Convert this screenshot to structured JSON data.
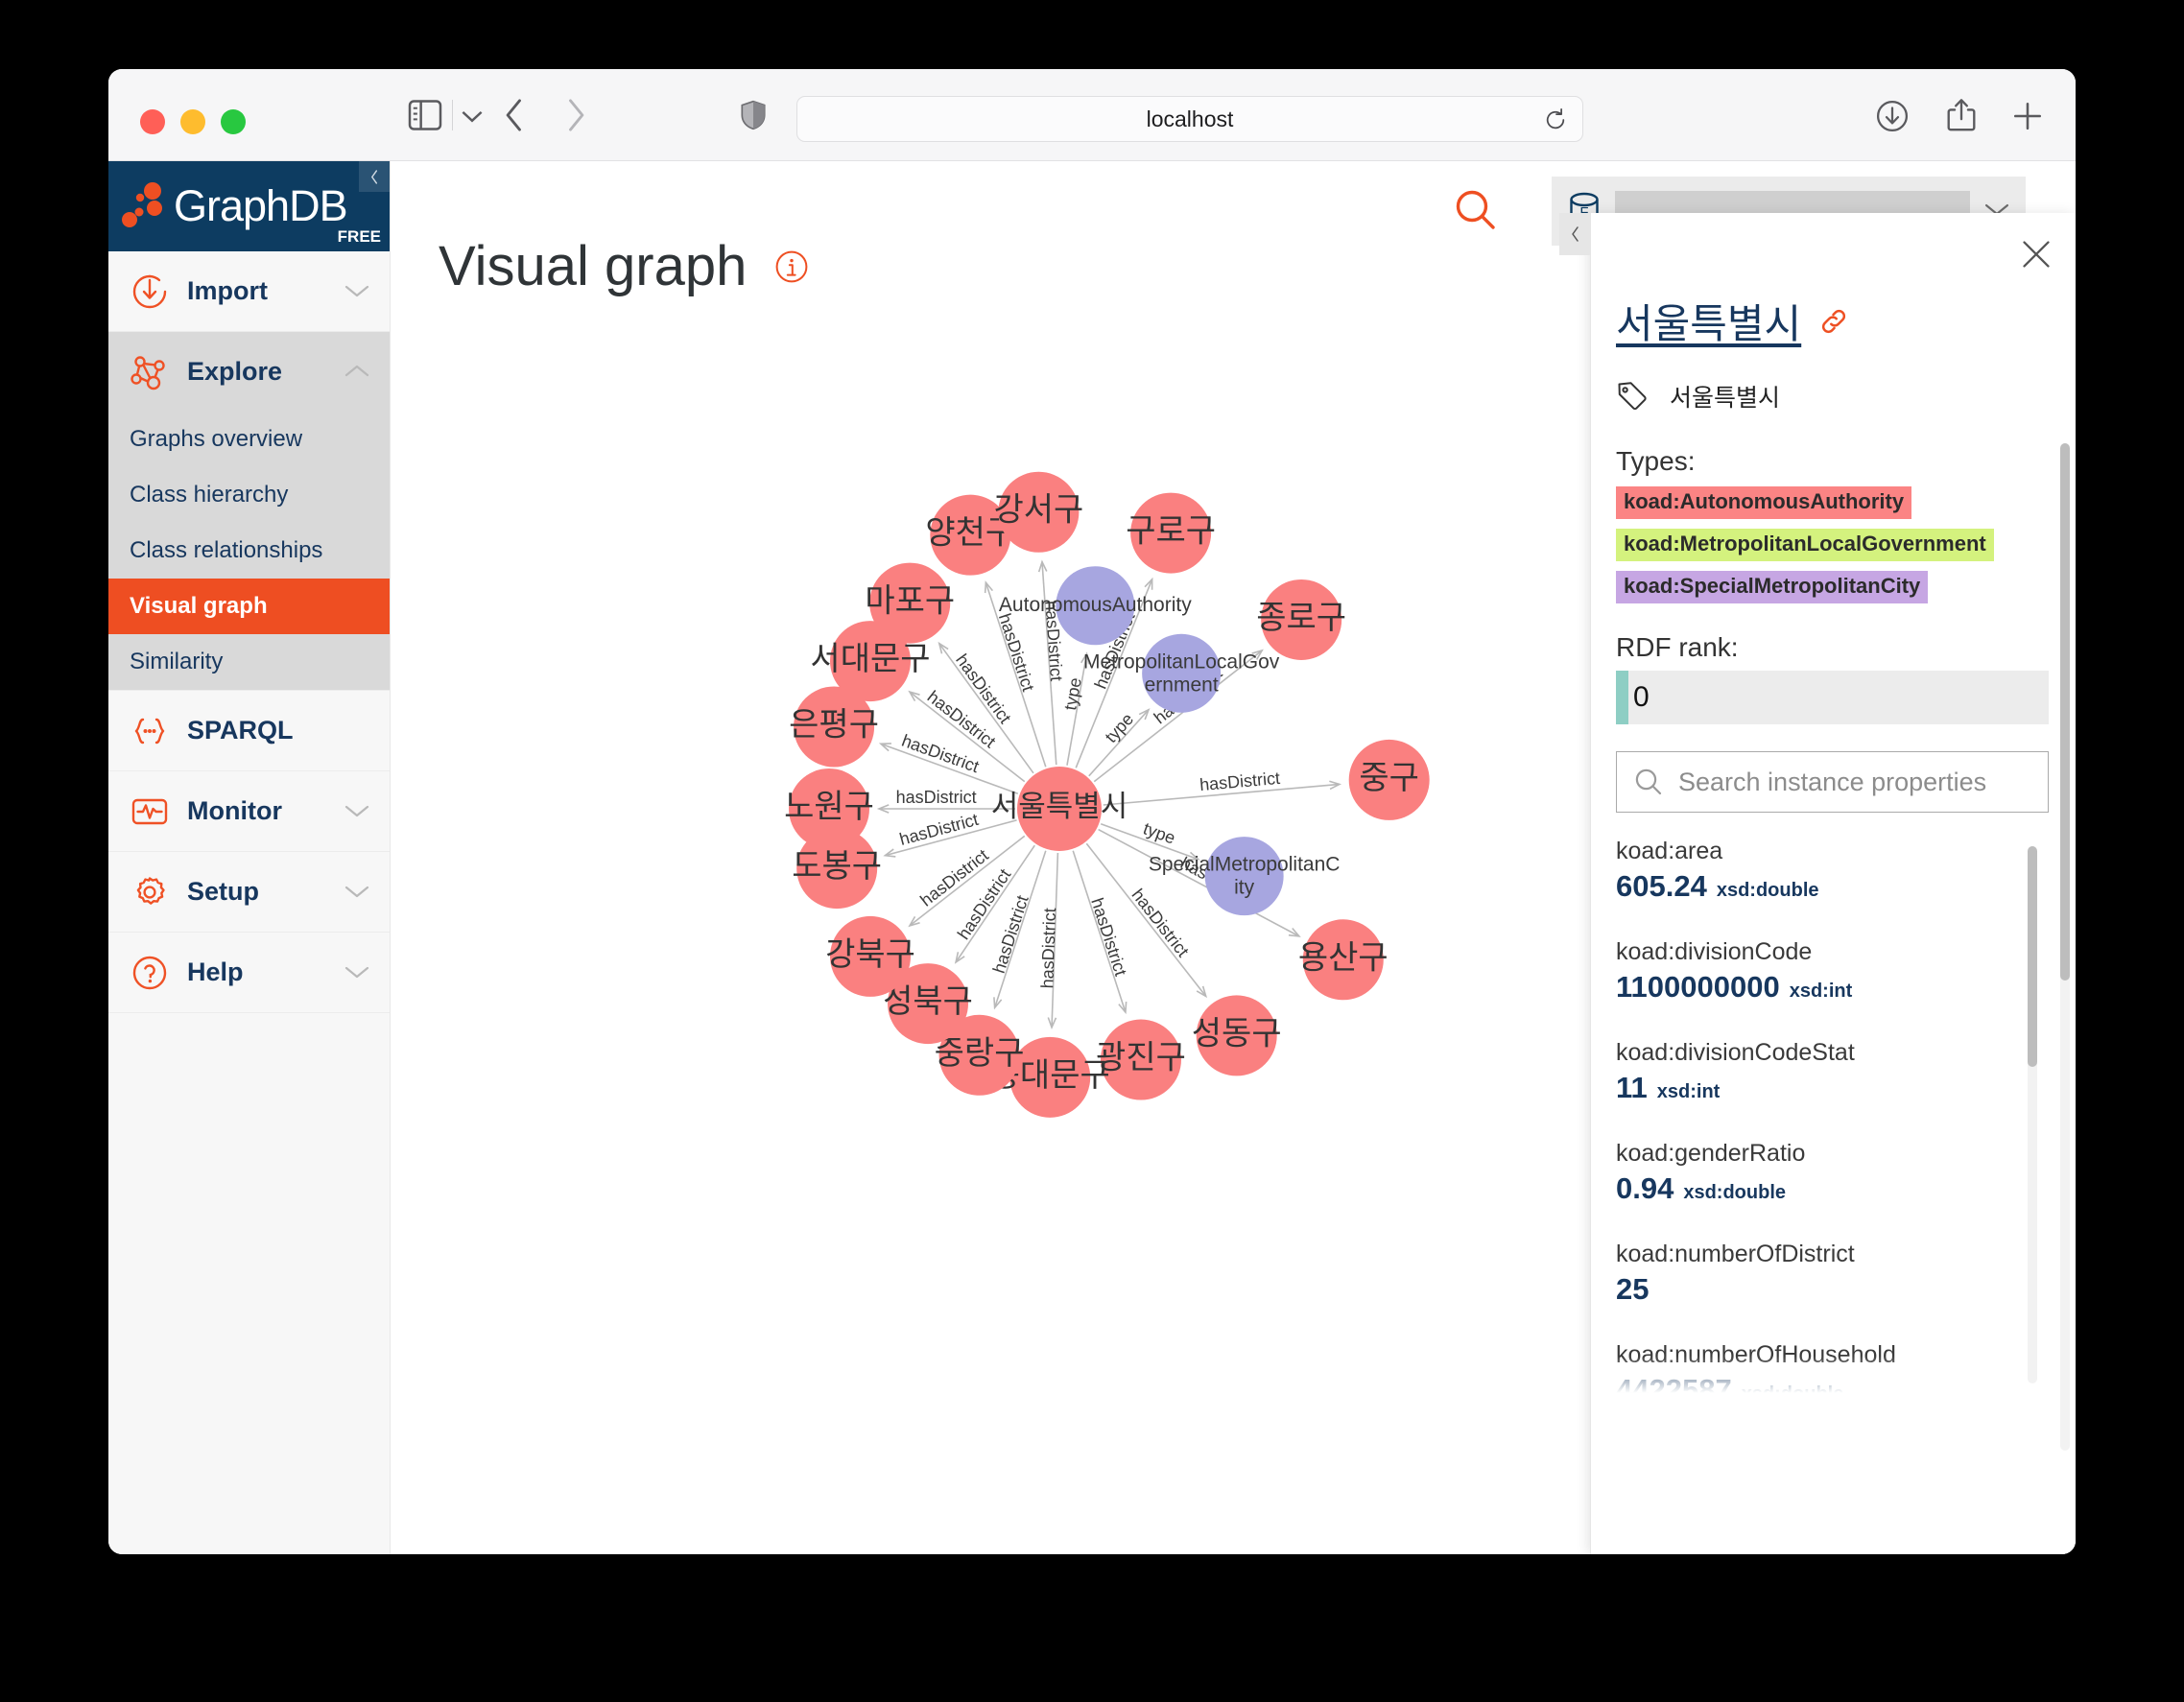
{
  "browser": {
    "url": "localhost",
    "icons": {
      "sidebar_toggle": "sidebar-toggle-icon",
      "sidebar_chevron": "chevron-down-icon",
      "back": "chevron-left-icon",
      "forward": "chevron-right-icon",
      "shield": "shield-icon",
      "reload": "reload-icon",
      "download": "download-icon",
      "share": "share-icon",
      "newtab": "plus-icon",
      "tabgroups": "tab-overview-icon"
    }
  },
  "sidebar": {
    "brand": "GraphDB",
    "edition_badge": "FREE",
    "collapse_label": "‹",
    "groups": [
      {
        "label": "Import",
        "icon": "import-icon",
        "chevron": "chevron-down",
        "open": false,
        "items": []
      },
      {
        "label": "Explore",
        "icon": "explore-graph-icon",
        "chevron": "chevron-up",
        "open": true,
        "items": [
          {
            "label": "Graphs overview",
            "active": false
          },
          {
            "label": "Class hierarchy",
            "active": false
          },
          {
            "label": "Class relationships",
            "active": false
          },
          {
            "label": "Visual graph",
            "active": true
          },
          {
            "label": "Similarity",
            "active": false
          }
        ]
      },
      {
        "label": "SPARQL",
        "icon": "sparql-braces-icon",
        "chevron": "none",
        "open": false,
        "items": []
      },
      {
        "label": "Monitor",
        "icon": "monitor-pulse-icon",
        "chevron": "chevron-down",
        "open": false,
        "items": []
      },
      {
        "label": "Setup",
        "icon": "gear-icon",
        "chevron": "chevron-down",
        "open": false,
        "items": []
      },
      {
        "label": "Help",
        "icon": "question-circle-icon",
        "chevron": "chevron-down",
        "open": false,
        "items": []
      }
    ]
  },
  "header": {
    "page_title": "Visual graph",
    "info_icon": "info-circle-icon",
    "search_icon": "search-icon",
    "repository_icon": "database-free-icon",
    "repository_value": "",
    "repository_chevron": "chevron-down-icon",
    "scroll_top_icon": "arrow-up-circle-icon"
  },
  "info_panel": {
    "collapse_icon": "chevron-left-icon",
    "close_icon": "close-icon",
    "entity_title": "서울특별시",
    "entity_link_icon": "link-icon",
    "entity_tag_icon": "tag-icon",
    "entity_label": "서울특별시",
    "types_heading": "Types:",
    "types": [
      "koad:AutonomousAuthority",
      "koad:MetropolitanLocalGovernment",
      "koad:SpecialMetropolitanCity"
    ],
    "type_colors": [
      "#fb8484",
      "#d4f27e",
      "#c6a6e3"
    ],
    "rdf_rank_heading": "RDF rank:",
    "rdf_rank_value": "0",
    "search_placeholder": "Search instance properties",
    "search_icon": "search-icon",
    "properties": [
      {
        "key": "koad:area",
        "value": "605.24",
        "datatype": "xsd:double"
      },
      {
        "key": "koad:divisionCode",
        "value": "1100000000",
        "datatype": "xsd:int"
      },
      {
        "key": "koad:divisionCodeStat",
        "value": "11",
        "datatype": "xsd:int"
      },
      {
        "key": "koad:genderRatio",
        "value": "0.94",
        "datatype": "xsd:double"
      },
      {
        "key": "koad:numberOfDistrict",
        "value": "25",
        "datatype": ""
      },
      {
        "key": "koad:numberOfHousehold",
        "value": "4422587",
        "datatype": "xsd:double"
      }
    ]
  },
  "chart_data": {
    "type": "diagram",
    "layout": "radial",
    "title": "Visual graph",
    "center_node": {
      "id": "서울특별시",
      "label": "서울특별시",
      "color": "#fa8080",
      "r": 44
    },
    "node_colors": {
      "instance": "#fa8080",
      "class": "#a7a6e0"
    },
    "edge_labels": {
      "hasDistrict": "hasDistrict",
      "type": "type"
    },
    "nodes": [
      {
        "label": "양천구",
        "color": "#fa8080",
        "r": 42,
        "angle_deg": 108,
        "edge": "hasDistrict"
      },
      {
        "label": "강서구",
        "color": "#fa8080",
        "r": 42,
        "angle_deg": 94,
        "edge": "hasDistrict"
      },
      {
        "label": "구로구",
        "color": "#fa8080",
        "r": 42,
        "angle_deg": 68,
        "edge": "hasDistrict"
      },
      {
        "label": "종로구",
        "color": "#fa8080",
        "r": 42,
        "angle_deg": 38,
        "edge": "hasDistrict"
      },
      {
        "label": "중구",
        "color": "#fa8080",
        "r": 42,
        "angle_deg": 5,
        "edge": "hasDistrict"
      },
      {
        "label": "용산구",
        "color": "#fa8080",
        "r": 42,
        "angle_deg": -28,
        "edge": "hasDistrict"
      },
      {
        "label": "성동구",
        "color": "#fa8080",
        "r": 42,
        "angle_deg": -52,
        "edge": "hasDistrict"
      },
      {
        "label": "광진구",
        "color": "#fa8080",
        "r": 42,
        "angle_deg": -72,
        "edge": "hasDistrict"
      },
      {
        "label": "동대문구",
        "color": "#fa8080",
        "r": 42,
        "angle_deg": -92,
        "edge": "hasDistrict"
      },
      {
        "label": "중랑구",
        "color": "#fa8080",
        "r": 42,
        "angle_deg": -108,
        "edge": "hasDistrict"
      },
      {
        "label": "성북구",
        "color": "#fa8080",
        "r": 42,
        "angle_deg": -124,
        "edge": "hasDistrict"
      },
      {
        "label": "강북구",
        "color": "#fa8080",
        "r": 42,
        "angle_deg": -142,
        "edge": "hasDistrict"
      },
      {
        "label": "도봉구",
        "color": "#fa8080",
        "r": 42,
        "angle_deg": -165,
        "edge": "hasDistrict"
      },
      {
        "label": "노원구",
        "color": "#fa8080",
        "r": 42,
        "angle_deg": 180,
        "edge": "hasDistrict"
      },
      {
        "label": "은평구",
        "color": "#fa8080",
        "r": 42,
        "angle_deg": 160,
        "edge": "hasDistrict"
      },
      {
        "label": "서대문구",
        "color": "#fa8080",
        "r": 42,
        "angle_deg": 142,
        "edge": "hasDistrict"
      },
      {
        "label": "마포구",
        "color": "#fa8080",
        "r": 42,
        "angle_deg": 126,
        "edge": "hasDistrict"
      },
      {
        "label": "AutonomousAuthority",
        "color": "#a7a6e0",
        "r": 41,
        "angle_deg": 80,
        "edge": "type"
      },
      {
        "label": "MetropolitanLocalGovernment",
        "color": "#a7a6e0",
        "r": 41,
        "angle_deg": 48,
        "edge": "type"
      },
      {
        "label": "SpecialMetropolitanCity",
        "color": "#a7a6e0",
        "r": 41,
        "angle_deg": -20,
        "edge": "type"
      }
    ]
  }
}
